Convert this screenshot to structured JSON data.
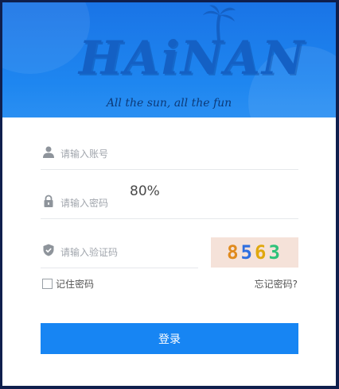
{
  "banner": {
    "logo": "HAiNAN",
    "tagline": "All the sun, all the fun"
  },
  "form": {
    "username_placeholder": "请输入账号",
    "password_placeholder": "请输入密码",
    "password_overlay_text": "80%",
    "captcha_placeholder": "请输入验证码",
    "captcha_code": [
      "8",
      "5",
      "6",
      "3"
    ],
    "remember_label": "记住密码",
    "forgot_label": "忘记密码?",
    "login_label": "登录"
  },
  "colors": {
    "accent": "#1785f3",
    "banner": "#1a74e6"
  },
  "icons": {
    "username": "user-icon",
    "password": "lock-icon",
    "captcha": "shield-icon"
  }
}
